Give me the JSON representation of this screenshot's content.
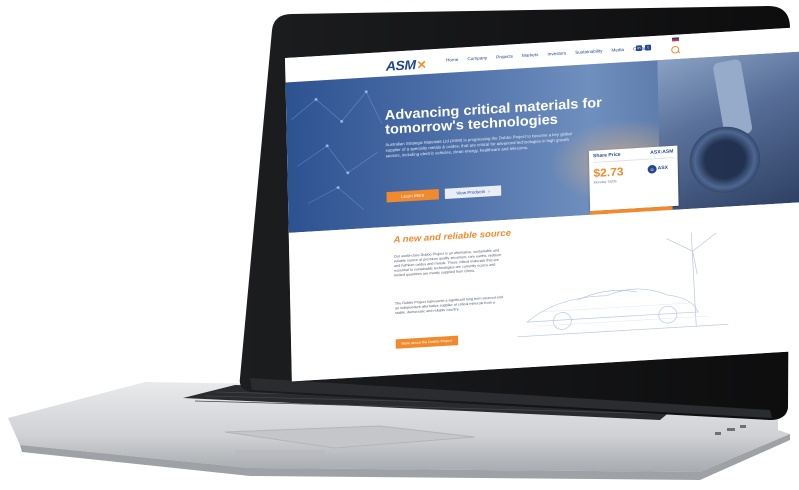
{
  "site": {
    "logo_text": "ASM",
    "logo_mark": "✕",
    "nav": [
      "Home",
      "Company",
      "Projects",
      "Markets",
      "Investors",
      "Sustainability",
      "Media",
      "Contact"
    ],
    "social_icons": [
      "linkedin-icon",
      "twitter-icon"
    ]
  },
  "hero": {
    "title": "Advancing critical materials for tomorrow's technologies",
    "text": "Australian Strategic Materials Ltd (ASM) is progressing the Dubbo Project to become a key global supplier of a specialty metals & oxides, that are critical for advanced technologies in high growth sectors, including electric vehicles, clean energy, healthcare and telecoms.",
    "btn_primary": "Learn More",
    "btn_secondary": "View Products",
    "btn_secondary_icon": "›"
  },
  "share": {
    "heading": "Share Price",
    "ticker": "ASX:ASM",
    "price": "$2.73",
    "date": "Monday 18/05",
    "exchange": "ASX",
    "button": "Latest Announcements",
    "button_icon": "›"
  },
  "section": {
    "title": "A new and reliable source",
    "para1": "Our world-class Dubbo Project is an alternative, sustainable and reliable source of premium quality zirconium, rare earths, niobium and hafnium oxides and metals. These critical materials that are essential to sustainable technologies are currently scarce and limited quantities are mostly supplied from China.",
    "para2": "The Dubbo Project represents a significant long term sourced and an independent alternative supplier of critical minerals from a stable, democratic and reliable country.",
    "button": "More about the Dubbo Project"
  },
  "colors": {
    "brand_blue": "#24468f",
    "accent_orange": "#f08a2c"
  }
}
